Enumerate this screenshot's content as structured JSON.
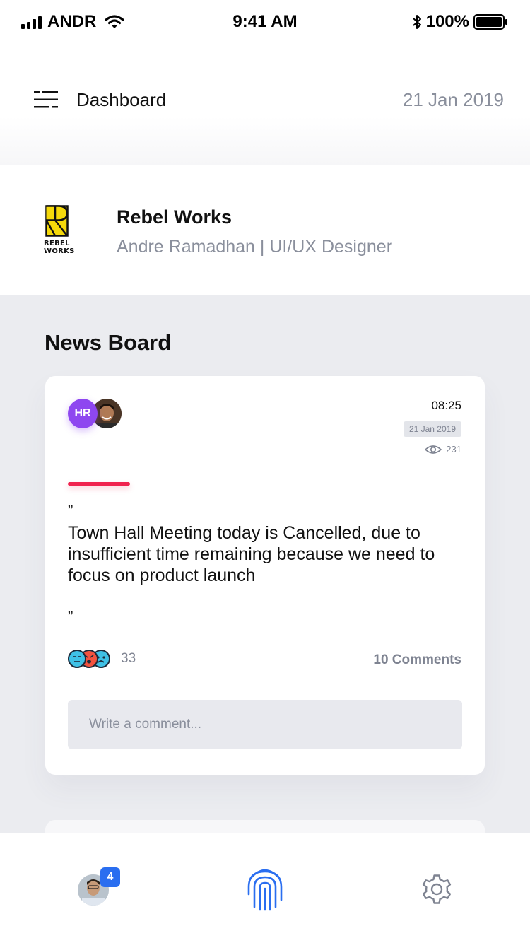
{
  "status_bar": {
    "carrier": "ANDR",
    "time": "9:41 AM",
    "battery": "100%"
  },
  "header": {
    "title": "Dashboard",
    "date": "21 Jan 2019"
  },
  "company": {
    "logo_line1": "REBEL",
    "logo_line2": "WORKS",
    "name": "Rebel Works",
    "subtitle": "Andre Ramadhan | UI/UX Designer"
  },
  "news_board": {
    "title": "News Board",
    "post": {
      "author_initials": "HR",
      "time": "08:25",
      "date": "21 Jan 2019",
      "views": "231",
      "quote_open": "”",
      "message": "Town Hall Meeting today is Cancelled, due to insufficient time remaining because we need to focus on product launch",
      "quote_close": "”",
      "reaction_count": "33",
      "comments": "10 Comments",
      "comment_placeholder": "Write a comment..."
    }
  },
  "tab_bar": {
    "notification_count": "4",
    "icons": [
      "profile-avatar",
      "fingerprint-icon",
      "gear-icon"
    ]
  },
  "colors": {
    "accent": "#2a6ef0",
    "hr_avatar": "#8e47f0",
    "red_line": "#f0234f",
    "muted_text": "#8a8f9c"
  }
}
